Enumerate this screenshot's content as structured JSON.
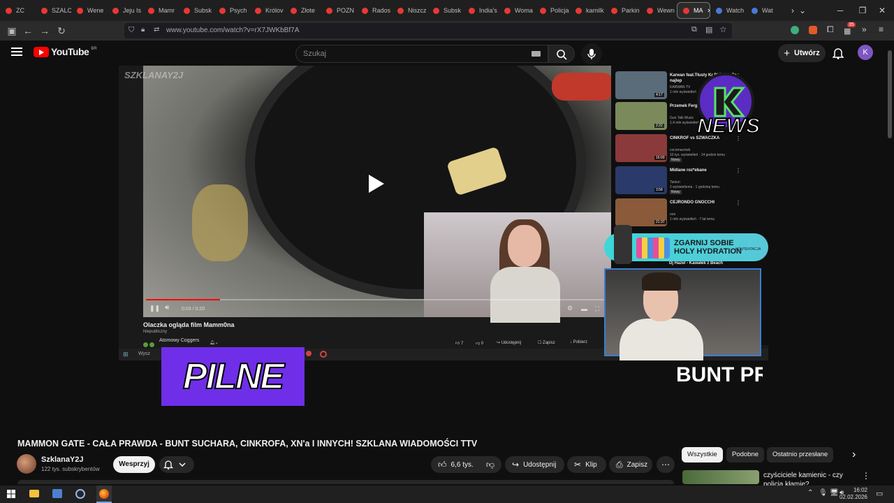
{
  "browser": {
    "tabs": [
      {
        "label": "ZC",
        "icon": "page-icon"
      },
      {
        "label": "SZALC",
        "icon": "youtube-icon"
      },
      {
        "label": "Wene",
        "icon": "youtube-icon"
      },
      {
        "label": "Jeju Is",
        "icon": "youtube-icon"
      },
      {
        "label": "Mamr",
        "icon": "youtube-icon"
      },
      {
        "label": "Subsk",
        "icon": "youtube-icon"
      },
      {
        "label": "Psych",
        "icon": "youtube-icon"
      },
      {
        "label": "Królov",
        "icon": "youtube-icon"
      },
      {
        "label": "Złote",
        "icon": "youtube-icon"
      },
      {
        "label": "POZN",
        "icon": "youtube-icon"
      },
      {
        "label": "Rados",
        "icon": "youtube-icon"
      },
      {
        "label": "Niszcz",
        "icon": "youtube-icon"
      },
      {
        "label": "Subsk",
        "icon": "youtube-icon"
      },
      {
        "label": "India's",
        "icon": "youtube-icon"
      },
      {
        "label": "Woma",
        "icon": "youtube-icon"
      },
      {
        "label": "Policja",
        "icon": "youtube-icon"
      },
      {
        "label": "kamilk",
        "icon": "youtube-icon"
      },
      {
        "label": "Parkin",
        "icon": "youtube-icon"
      },
      {
        "label": "Wewn",
        "icon": "youtube-icon"
      },
      {
        "label": "MA",
        "icon": "youtube-icon",
        "active": true
      },
      {
        "label": "Watch",
        "icon": "globe-icon"
      },
      {
        "label": "Wat",
        "icon": "globe-icon"
      }
    ],
    "url": "www.youtube.com/watch?v=rX7JWKbBf7A",
    "extension_badge": "35"
  },
  "youtube": {
    "logo_text": "YouTube",
    "country_code": "BR",
    "search_placeholder": "Szukaj",
    "create_label": "Utwórz",
    "avatar_letter": "K"
  },
  "player": {
    "watermark": "SZKLANAY2J",
    "time": "0:03 / 0:20",
    "progress": 0.16,
    "inner_title": "Olaczka ogląda film Mamm0na",
    "inner_sub": "Niepubliczny",
    "inner_channel": "Atomowy Coggers",
    "inner_actions": [
      "7",
      "0",
      "Udostępnij",
      "Zapisz",
      "Pobierz"
    ],
    "inner_search": "Wysz"
  },
  "inner_sidebar": [
    {
      "title": "Karwan feat.Tłusty Kr Dj DBT - Za najlep",
      "channel": "KARWAN TV",
      "meta": "1 mln wyświetleń",
      "duration": "4:17"
    },
    {
      "title": "Przemek Ferg prod. M.K bez",
      "channel": "Gun Talk Music",
      "meta": "1,4 mln wyświetleń",
      "duration": "2:22"
    },
    {
      "title": "CINKROF vs SZWACZKA",
      "channel": "cocomacmek",
      "meta": "10 tys. wyświetleń · 14 godzin temu",
      "duration": "16:00",
      "badge": "Nowy"
    },
    {
      "title": "Midlane roz*ebane",
      "channel": "Tastun",
      "meta": "2 wyświetlenia · 1 godzinę temu",
      "duration": "3:58",
      "badge": "Nowy"
    },
    {
      "title": "CEJRONDO GNOCCHI",
      "channel": "ooo",
      "meta": "1 mln wyświetleń · 7 lat temu",
      "duration": "21:37"
    },
    {
      "title": "Dj Hazel - Kawałek z Beach",
      "channel": "",
      "meta": "",
      "duration": ""
    }
  ],
  "overlays": {
    "news_logo": "NEWS",
    "ad_line1": "ZGARNIJ SOBIE",
    "ad_line2": "HOLY HYDRATION",
    "ad_tag": "KONTENTACJA",
    "pilne": "PILNE",
    "ticker": "BUNT PRZ"
  },
  "video": {
    "title": "MAMMON GATE - CAŁA PRAWDA - BUNT SUCHARA, CINKROFA, XN'a I INNYCH! SZKLANA WIADOMOŚCI TTV",
    "channel": "SzklanaY2J",
    "subscribers": "122 tys. subskrybentów",
    "support_label": "Wesprzyj",
    "likes": "6,6 tys.",
    "share_label": "Udostępnij",
    "clip_label": "Klip",
    "save_label": "Zapisz"
  },
  "chips": [
    "Wszystkie",
    "Podobne",
    "Ostatnio przesłane"
  ],
  "recommendation": {
    "title": "czyściciele kamienic - czy policja kłamie?"
  },
  "os": {
    "time": "16:02",
    "date": "02.02.2026"
  }
}
